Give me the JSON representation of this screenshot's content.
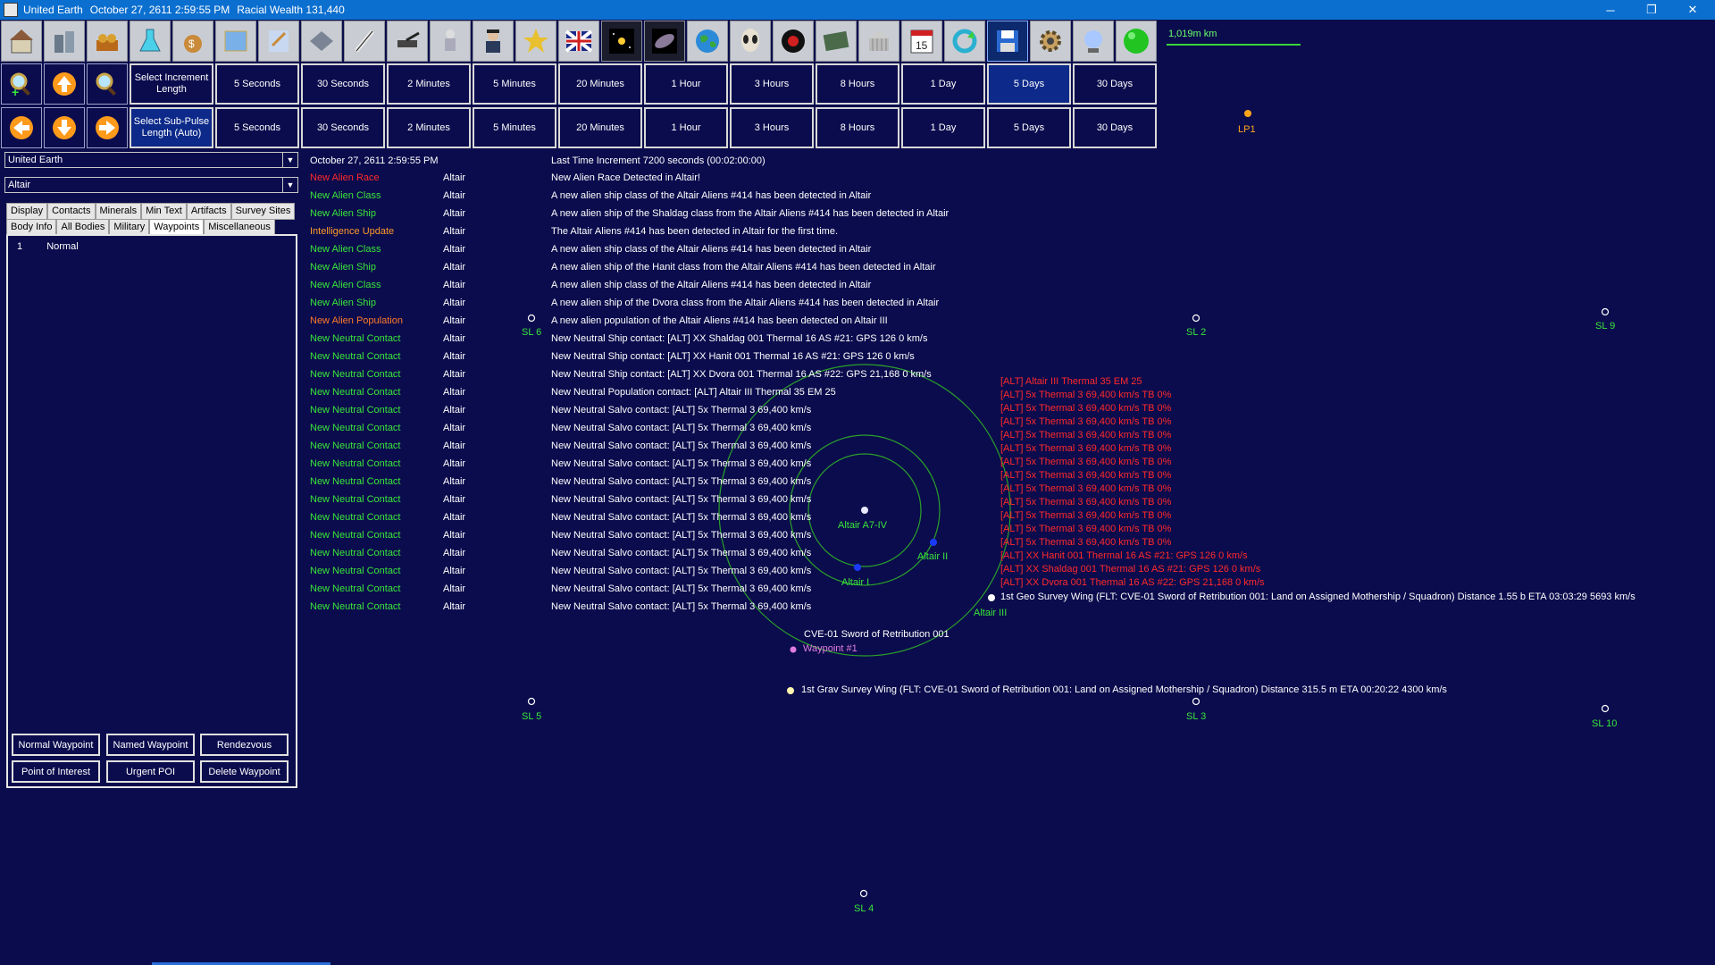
{
  "window": {
    "app": "United Earth",
    "datetime": "October 27, 2611 2:59:55 PM",
    "wealth": "Racial Wealth 131,440",
    "min": "─",
    "max": "❐",
    "close": "✕"
  },
  "toolbar": {
    "icons": [
      "colony-icon",
      "industry-icon",
      "mining-icon",
      "research-icon",
      "wealth-icon",
      "design-icon",
      "class-design-icon",
      "fleet-icon",
      "missile-icon",
      "ground-units-icon",
      "troop-icon",
      "commander-icon",
      "medal-icon",
      "race-flag-icon",
      "system-view-icon",
      "galaxy-map-icon",
      "globe-icon",
      "alien-icon",
      "intelligence-icon",
      "event-icon",
      "government-icon",
      "calendar-icon",
      "refresh-icon",
      "save-icon",
      "settings-icon",
      "sphere-icon",
      "green-orb-icon"
    ],
    "scale": "1,019m km"
  },
  "row1": {
    "label": "Select Increment Length",
    "buttons": [
      "5 Seconds",
      "30 Seconds",
      "2 Minutes",
      "5 Minutes",
      "20 Minutes",
      "1 Hour",
      "3 Hours",
      "8 Hours",
      "1 Day",
      "5 Days",
      "30 Days"
    ],
    "selected_index": 9
  },
  "row2": {
    "label": "Select Sub-Pulse Length (Auto)",
    "buttons": [
      "5 Seconds",
      "30 Seconds",
      "2 Minutes",
      "5 Minutes",
      "20 Minutes",
      "1 Hour",
      "3 Hours",
      "8 Hours",
      "1 Day",
      "5 Days",
      "30 Days"
    ]
  },
  "panel": {
    "race": "United Earth",
    "system": "Altair",
    "tabs_row1": [
      "Display",
      "Contacts",
      "Minerals",
      "Min Text",
      "Artifacts",
      "Survey Sites"
    ],
    "tabs_row2": [
      "Body Info",
      "All Bodies",
      "Military",
      "Waypoints",
      "Miscellaneous"
    ],
    "selected_tab": "Waypoints",
    "waypoints": [
      {
        "num": "1",
        "type": "Normal"
      }
    ],
    "buttons": [
      "Normal Waypoint",
      "Named Waypoint",
      "Rendezvous",
      "Point of Interest",
      "Urgent POI",
      "Delete Waypoint"
    ]
  },
  "log": {
    "date": "October 27, 2611 2:59:55 PM",
    "increment": "Last Time Increment 7200 seconds (00:02:00:00)",
    "events": [
      {
        "type": "New Alien Race",
        "color": "#ff2a2a",
        "system": "Altair",
        "text": "New Alien Race Detected in Altair!"
      },
      {
        "type": "New Alien Class",
        "color": "#39e639",
        "system": "Altair",
        "text": "A new alien ship class of the Altair Aliens #414 has been detected in Altair"
      },
      {
        "type": "New Alien Ship",
        "color": "#39e639",
        "system": "Altair",
        "text": "A new alien ship of the Shaldag class from the Altair Aliens #414 has been detected in Altair"
      },
      {
        "type": "Intelligence Update",
        "color": "#ff9a2a",
        "system": "Altair",
        "text": "The Altair Aliens #414 has been detected in Altair for the first time."
      },
      {
        "type": "New Alien Class",
        "color": "#39e639",
        "system": "Altair",
        "text": "A new alien ship class of the Altair Aliens #414 has been detected in Altair"
      },
      {
        "type": "New Alien Ship",
        "color": "#39e639",
        "system": "Altair",
        "text": "A new alien ship of the Hanit class from the Altair Aliens #414 has been detected in Altair"
      },
      {
        "type": "New Alien Class",
        "color": "#39e639",
        "system": "Altair",
        "text": "A new alien ship class of the Altair Aliens #414 has been detected in Altair"
      },
      {
        "type": "New Alien Ship",
        "color": "#39e639",
        "system": "Altair",
        "text": "A new alien ship of the Dvora class from the Altair Aliens #414 has been detected in Altair"
      },
      {
        "type": "New Alien Population",
        "color": "#ff7a2a",
        "system": "Altair",
        "text": "A new alien population of the Altair Aliens #414 has been detected on Altair III"
      },
      {
        "type": "New Neutral Contact",
        "color": "#39e639",
        "system": "Altair",
        "text": "New Neutral Ship contact:  [ALT]  XX Shaldag 001    Thermal 16    AS #21: GPS 126    0 km/s"
      },
      {
        "type": "New Neutral Contact",
        "color": "#39e639",
        "system": "Altair",
        "text": "New Neutral Ship contact:  [ALT]  XX Hanit 001    Thermal 16    AS #21: GPS 126    0 km/s"
      },
      {
        "type": "New Neutral Contact",
        "color": "#39e639",
        "system": "Altair",
        "text": "New Neutral Ship contact:  [ALT]  XX Dvora 001    Thermal 16    AS #22: GPS 21,168    0 km/s"
      },
      {
        "type": "New Neutral Contact",
        "color": "#39e639",
        "system": "Altair",
        "text": "New Neutral Population contact:  [ALT]  Altair III    Thermal 35    EM 25"
      },
      {
        "type": "New Neutral Contact",
        "color": "#39e639",
        "system": "Altair",
        "text": "New Neutral Salvo contact:  [ALT] 5x Thermal 3  69,400 km/s"
      },
      {
        "type": "New Neutral Contact",
        "color": "#39e639",
        "system": "Altair",
        "text": "New Neutral Salvo contact:  [ALT] 5x Thermal 3  69,400 km/s"
      },
      {
        "type": "New Neutral Contact",
        "color": "#39e639",
        "system": "Altair",
        "text": "New Neutral Salvo contact:  [ALT] 5x Thermal 3  69,400 km/s"
      },
      {
        "type": "New Neutral Contact",
        "color": "#39e639",
        "system": "Altair",
        "text": "New Neutral Salvo contact:  [ALT] 5x Thermal 3  69,400 km/s"
      },
      {
        "type": "New Neutral Contact",
        "color": "#39e639",
        "system": "Altair",
        "text": "New Neutral Salvo contact:  [ALT] 5x Thermal 3  69,400 km/s"
      },
      {
        "type": "New Neutral Contact",
        "color": "#39e639",
        "system": "Altair",
        "text": "New Neutral Salvo contact:  [ALT] 5x Thermal 3  69,400 km/s"
      },
      {
        "type": "New Neutral Contact",
        "color": "#39e639",
        "system": "Altair",
        "text": "New Neutral Salvo contact:  [ALT] 5x Thermal 3  69,400 km/s"
      },
      {
        "type": "New Neutral Contact",
        "color": "#39e639",
        "system": "Altair",
        "text": "New Neutral Salvo contact:  [ALT] 5x Thermal 3  69,400 km/s"
      },
      {
        "type": "New Neutral Contact",
        "color": "#39e639",
        "system": "Altair",
        "text": "New Neutral Salvo contact:  [ALT] 5x Thermal 3  69,400 km/s"
      },
      {
        "type": "New Neutral Contact",
        "color": "#39e639",
        "system": "Altair",
        "text": "New Neutral Salvo contact:  [ALT] 5x Thermal 3  69,400 km/s"
      },
      {
        "type": "New Neutral Contact",
        "color": "#39e639",
        "system": "Altair",
        "text": "New Neutral Salvo contact:  [ALT] 5x Thermal 3  69,400 km/s"
      },
      {
        "type": "New Neutral Contact",
        "color": "#39e639",
        "system": "Altair",
        "text": "New Neutral Salvo contact:  [ALT] 5x Thermal 3  69,400 km/s"
      }
    ]
  },
  "map": {
    "survey_locations": [
      "SL 6",
      "SL 2",
      "SL 9",
      "SL 5",
      "SL 3",
      "SL 10",
      "SL 4"
    ],
    "lagrange": "LP1",
    "bodies": [
      "Altair A7-IV",
      "Altair II",
      "Altair I",
      "Altair III"
    ],
    "waypoint": "Waypoint #1",
    "fleet": "CVE-01 Sword of Retribution 001",
    "geo_wing": "1st Geo Survey Wing  (FLT: CVE-01 Sword of Retribution 001: Land on Assigned Mothership / Squadron)   Distance 1.55 b   ETA 03:03:29   5693 km/s",
    "grav_wing": "1st Grav Survey Wing  (FLT: CVE-01 Sword of Retribution 001: Land on Assigned Mothership / Squadron)   Distance 315.5 m   ETA 00:20:22   4300 km/s",
    "contacts": [
      "[ALT]  Altair III    Thermal 35    EM 25",
      "[ALT] 5x Thermal 3  69,400 km/s   TB 0%",
      "[ALT] 5x Thermal 3  69,400 km/s   TB 0%",
      "[ALT] 5x Thermal 3  69,400 km/s   TB 0%",
      "[ALT] 5x Thermal 3  69,400 km/s   TB 0%",
      "[ALT] 5x Thermal 3  69,400 km/s   TB 0%",
      "[ALT] 5x Thermal 3  69,400 km/s   TB 0%",
      "[ALT] 5x Thermal 3  69,400 km/s   TB 0%",
      "[ALT] 5x Thermal 3  69,400 km/s   TB 0%",
      "[ALT] 5x Thermal 3  69,400 km/s   TB 0%",
      "[ALT] 5x Thermal 3  69,400 km/s   TB 0%",
      "[ALT] 5x Thermal 3  69,400 km/s   TB 0%",
      "[ALT] 5x Thermal 3  69,400 km/s   TB 0%",
      "[ALT]  XX Hanit 001    Thermal 16    AS #21: GPS 126    0 km/s",
      "[ALT]  XX Shaldag 001    Thermal 16    AS #21: GPS 126    0 km/s",
      "[ALT]  XX Dvora 001    Thermal 16    AS #22: GPS 21,168    0 km/s"
    ]
  },
  "colors": {
    "background": "#0b0c4d",
    "green": "#39e639",
    "red": "#ff2a2a",
    "orange": "#ff9a2a",
    "violet": "#e07ce0",
    "titlebar": "#0b6fd0"
  }
}
